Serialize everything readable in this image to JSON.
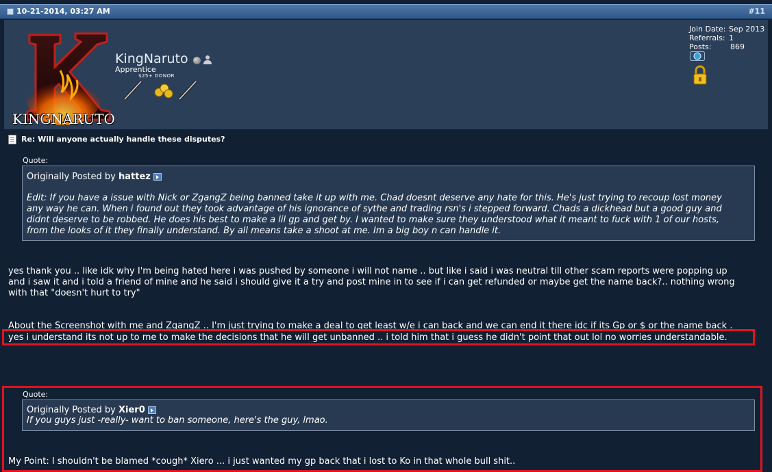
{
  "post": {
    "date": "10-21-2014, 03:27 AM",
    "number": "#11",
    "title": "Re: Will anyone actually handle these disputes?"
  },
  "user": {
    "avatar_text": "KINGNARUTO",
    "name": "KingNaruto",
    "title": "Apprentice",
    "donor_label": "$25+ DONOR",
    "stats": {
      "join_label": "Join Date:",
      "join_value": "Sep 2013",
      "referrals_label": "Referrals:",
      "referrals_value": "1",
      "posts_label": "Posts:",
      "posts_value": "869"
    }
  },
  "quote1": {
    "label": "Quote:",
    "prefix": "Originally Posted by",
    "author": "hattez",
    "lines": [
      "Edit: If you have a issue with Nick or ZgangZ being banned take it up with me. Chad doesnt deserve any hate for this. He's just trying to recoup lost money",
      "any way he can. When i found out they took advantage of his ignorance of sythe and trading rsn's i stepped forward. Chads a dickhead but a good guy and",
      "didnt deserve to be robbed. He does his best to make a lil gp and get by. I wanted to make sure they understood what it meant to fuck with 1 of our hosts,",
      "from the looks of it they finally understand. By all means take a shoot at me. Im a big boy n can handle it."
    ]
  },
  "message": {
    "p1": [
      "yes thank you .. like idk why I'm being hated here i was pushed by someone i will not name .. but like i said i was neutral till other scam reports were popping up",
      "and i saw it and i told a friend of mine and he said i should give it a try and post mine in to see if i can get refunded or maybe get the name back?.. nothing wrong",
      "with that \"doesn't hurt to try\""
    ],
    "p2_line1": "About the Screenshot with me and ZgangZ .. I'm just trying to make a deal to get least w/e i can back and we can end it there idc if its Gp or $ or the name back .",
    "p2_line2": "yes i understand its not up to me to make the decisions that he will get unbanned .. i told him that i guess he didn't point that out lol no worries understandable.",
    "p3": "My Point: I shouldn't be blamed *cough* Xiero ... i just wanted my gp back that i lost to Ko in that whole bull shit.."
  },
  "quote2": {
    "label": "Quote:",
    "prefix": "Originally Posted by",
    "author": "Xier0",
    "text": "If you guys just -really- want to ban someone, here's the guy, lmao."
  },
  "colors": {
    "page_bg": "#122033",
    "userbar_bg": "#2b3f59",
    "highlight": "#e0141f"
  }
}
